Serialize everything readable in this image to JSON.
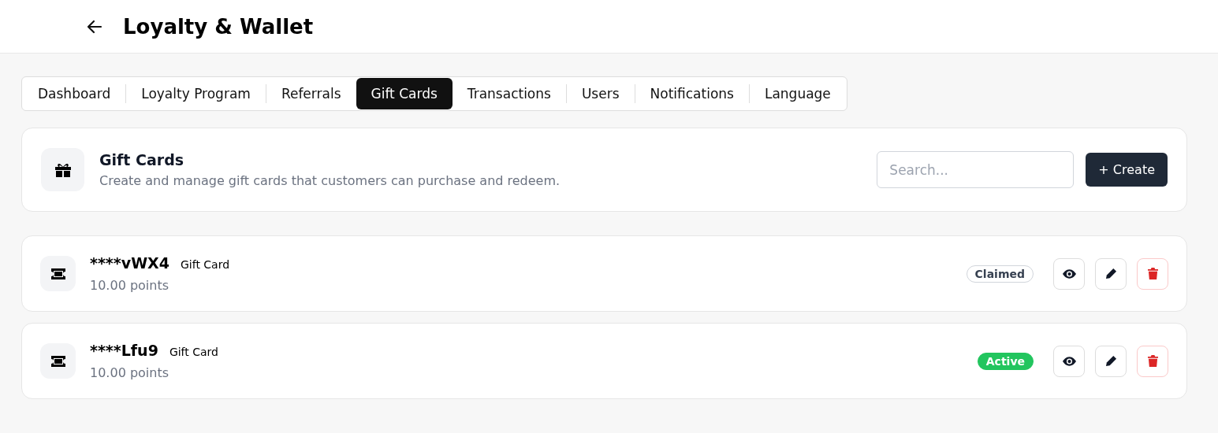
{
  "header": {
    "title": "Loyalty & Wallet"
  },
  "tabs": [
    {
      "label": "Dashboard",
      "selected": false
    },
    {
      "label": "Loyalty Program",
      "selected": false
    },
    {
      "label": "Referrals",
      "selected": false
    },
    {
      "label": "Gift Cards",
      "selected": true
    },
    {
      "label": "Transactions",
      "selected": false
    },
    {
      "label": "Users",
      "selected": false
    },
    {
      "label": "Notifications",
      "selected": false
    },
    {
      "label": "Language",
      "selected": false
    }
  ],
  "section": {
    "title": "Gift Cards",
    "description": "Create and manage gift cards that customers can purchase and redeem.",
    "search": {
      "placeholder": "Search..."
    },
    "create_button": "+ Create"
  },
  "cards": [
    {
      "code": "****vWX4",
      "type": "Gift Card",
      "amount": "10.00 points",
      "status": "Claimed",
      "kind": "claimed"
    },
    {
      "code": "****Lfu9",
      "type": "Gift Card",
      "amount": "10.00 points",
      "status": "Active",
      "kind": "active"
    }
  ]
}
